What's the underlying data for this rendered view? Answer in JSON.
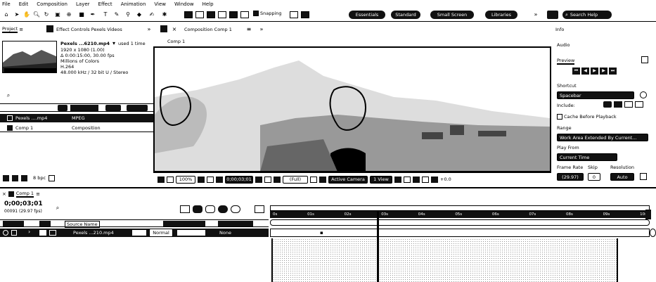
{
  "menu": [
    "File",
    "Edit",
    "Composition",
    "Layer",
    "Effect",
    "Animation",
    "View",
    "Window",
    "Help"
  ],
  "toolbar": {
    "snapping": "Snapping",
    "workspaces": [
      "Essentials",
      "Standard",
      "Small Screen",
      "Libraries"
    ],
    "search_help": "Search Help"
  },
  "panels": {
    "project_tab": "Project",
    "effect_controls_tab": "Effect Controls Pexels Videos",
    "composition_tab": "Composition Comp 1",
    "comp_subtab": "Comp 1"
  },
  "project": {
    "file_name": "Pexels ...6210.mp4",
    "used": "used 1 time",
    "info": [
      "1920 x 1080 (1.00)",
      "Δ 0:00:15:00, 30.00 fps",
      "Millions of Colors",
      "H.264",
      "48.000 kHz / 32 bit U / Stereo"
    ],
    "items": [
      {
        "name": "Pexels ....mp4",
        "type": "MPEG",
        "size": ""
      },
      {
        "name": "Comp 1",
        "type": "Composition",
        "size": ""
      }
    ],
    "bpc": "8 bpc"
  },
  "viewer": {
    "zoom": "100%",
    "timecode": "0;00;03;01",
    "resolution": "(Full)",
    "camera": "Active Camera",
    "view": "1 View",
    "exposure": "+0.0"
  },
  "right_panel": {
    "info": "Info",
    "audio": "Audio",
    "preview": "Preview",
    "shortcut_label": "Shortcut",
    "shortcut_value": "Spacebar",
    "include": "Include:",
    "cache": "Cache Before Playback",
    "range_label": "Range",
    "range_value": "Work Area Extended By Current...",
    "play_from_label": "Play From",
    "play_from_value": "Current Time",
    "frame_rate_label": "Frame Rate",
    "skip_label": "Skip",
    "resolution_label": "Resolution",
    "frame_rate_value": "(29.97)",
    "skip_value": "0",
    "resolution_value": "Auto"
  },
  "timeline": {
    "tab": "Comp 1",
    "timecode": "0;00;03;01",
    "frame_info": "00091 (29.97 fps)",
    "source_name_header": "Source Name",
    "layer_name": "Pexels ...210.mp4",
    "mode": "Normal",
    "parent": "None",
    "ruler_marks": [
      "0s",
      "01s",
      "02s",
      "03s",
      "04s",
      "05s",
      "06s",
      "07s",
      "08s",
      "09s",
      "10s"
    ]
  }
}
